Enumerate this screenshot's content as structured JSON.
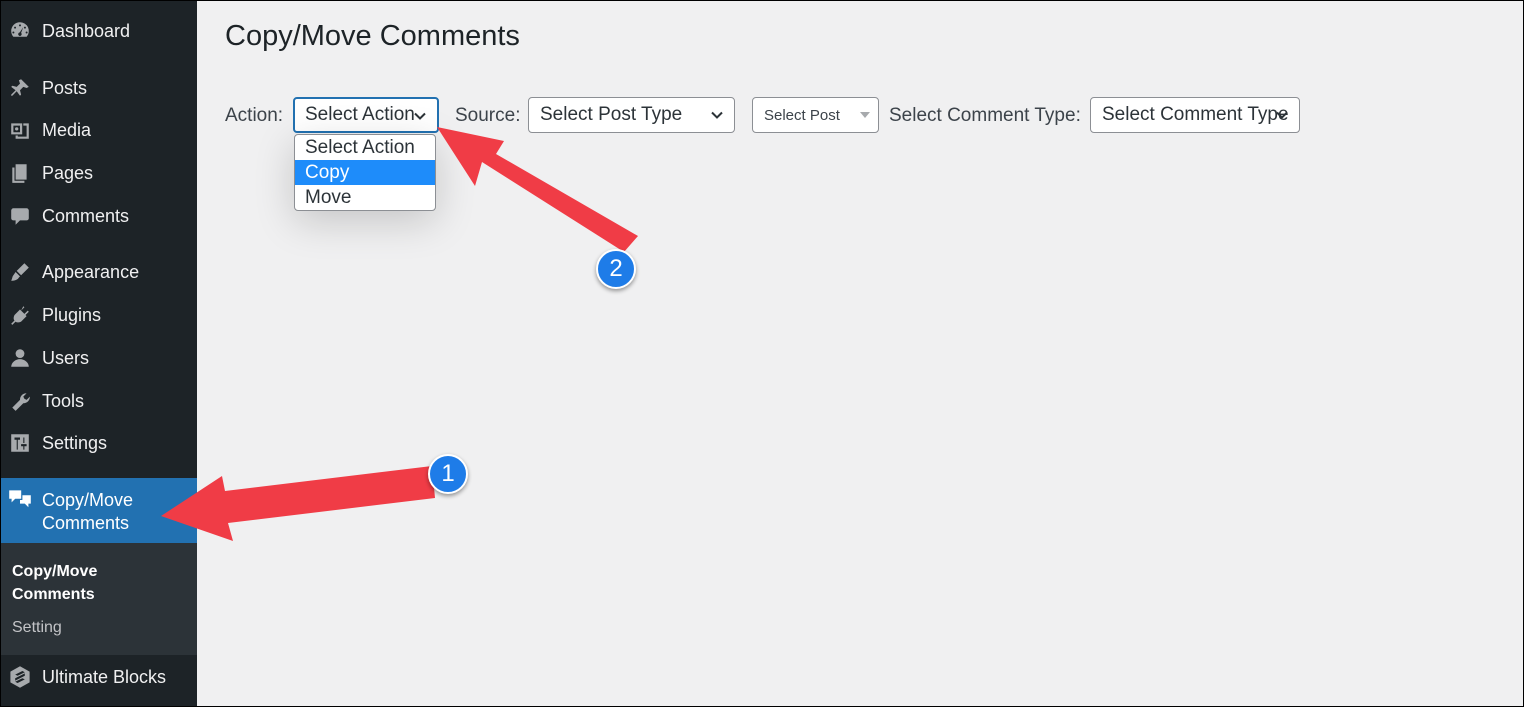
{
  "sidebar": {
    "items": [
      {
        "label": "Dashboard",
        "icon": "dashboard-icon"
      },
      {
        "label": "Posts",
        "icon": "pin-icon"
      },
      {
        "label": "Media",
        "icon": "media-icon"
      },
      {
        "label": "Pages",
        "icon": "pages-icon"
      },
      {
        "label": "Comments",
        "icon": "comment-icon"
      },
      {
        "label": "Appearance",
        "icon": "brush-icon"
      },
      {
        "label": "Plugins",
        "icon": "plug-icon"
      },
      {
        "label": "Users",
        "icon": "user-icon"
      },
      {
        "label": "Tools",
        "icon": "wrench-icon"
      },
      {
        "label": "Settings",
        "icon": "settings-icon"
      }
    ],
    "active": {
      "label": "Copy/Move Comments",
      "icon": "comments-icon"
    },
    "submenu": {
      "current": "Copy/Move Comments",
      "setting": "Setting"
    },
    "bottom": {
      "label": "Ultimate Blocks",
      "icon": "ultimate-blocks-icon"
    }
  },
  "main": {
    "title": "Copy/Move Comments",
    "action_label": "Action:",
    "action_select": "Select Action",
    "action_options": [
      "Select Action",
      "Copy",
      "Move"
    ],
    "highlighted_option": "Copy",
    "source_label": "Source:",
    "post_type_select": "Select Post Type",
    "post_select": "Select Post",
    "comment_type_label": "Select Comment Type:",
    "comment_type_select": "Select Comment Type"
  },
  "annotations": {
    "badge_1": "1",
    "badge_2": "2",
    "arrow_color": "#f03c46",
    "badge_color": "#1e7ce8"
  },
  "colors": {
    "sidebar_bg": "#1d2327",
    "active_bg": "#2271b1",
    "submenu_bg": "#2c3338",
    "highlight": "#1e8cfa"
  }
}
